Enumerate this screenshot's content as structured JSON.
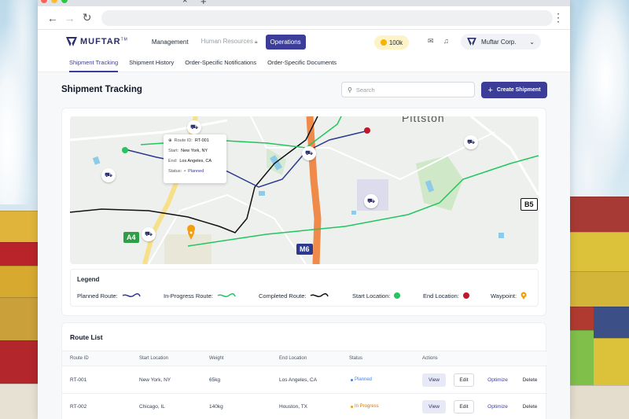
{
  "app": {
    "logo_text": "MUFTAR",
    "logo_tm": "TM",
    "nav": [
      {
        "label": "Management"
      },
      {
        "label": "Human Resources"
      },
      {
        "label": "Operations"
      }
    ],
    "coins": "100k",
    "company": "Muftar Corp."
  },
  "sub_nav": [
    {
      "label": "Shipment Tracking"
    },
    {
      "label": "Shipment History"
    },
    {
      "label": "Order-Specific Notifications"
    },
    {
      "label": "Order-Specific Documents"
    }
  ],
  "page": {
    "title": "Shipment Tracking",
    "search_placeholder": "Search",
    "create_label": "Create Shipment"
  },
  "map": {
    "town_label": "Pittston",
    "road_labels": [
      "A4",
      "M6",
      "B5"
    ],
    "tooltip": {
      "route_id_label": "Route ID:",
      "route_id": "RT-001",
      "start_label": "Start:",
      "start": "New York, NY",
      "end_label": "End:",
      "end": "Los Angeles, CA",
      "status_label": "Status:",
      "status": "Planned"
    }
  },
  "legend": {
    "title": "Legend",
    "items": [
      {
        "label": "Planned Route:",
        "color": "#2b3a8f"
      },
      {
        "label": "In-Progress Route:",
        "color": "#22c55e"
      },
      {
        "label": "Completed Route:",
        "color": "#111111"
      },
      {
        "label": "Start Location:",
        "color": "#22c55e"
      },
      {
        "label": "End Location:",
        "color": "#c0172b"
      },
      {
        "label": "Waypoint:",
        "color": "#f59e0b"
      }
    ]
  },
  "routes": {
    "title": "Route List",
    "columns": [
      "Route ID",
      "Start Location",
      "Weight",
      "End Location",
      "Status",
      "Actions"
    ],
    "rows": [
      {
        "id": "RT-001",
        "start": "New York, NY",
        "weight": "65kg",
        "end": "Los Angeles, CA",
        "status": "Planned",
        "status_color": "#3b82f6"
      },
      {
        "id": "RT-002",
        "start": "Chicago, IL",
        "weight": "140kg",
        "end": "Houston, TX",
        "status": "In Progress",
        "status_color": "#f59e0b"
      }
    ],
    "actions": {
      "view": "View",
      "edit": "Edit",
      "optimize": "Optimize",
      "delete": "Delete"
    }
  }
}
